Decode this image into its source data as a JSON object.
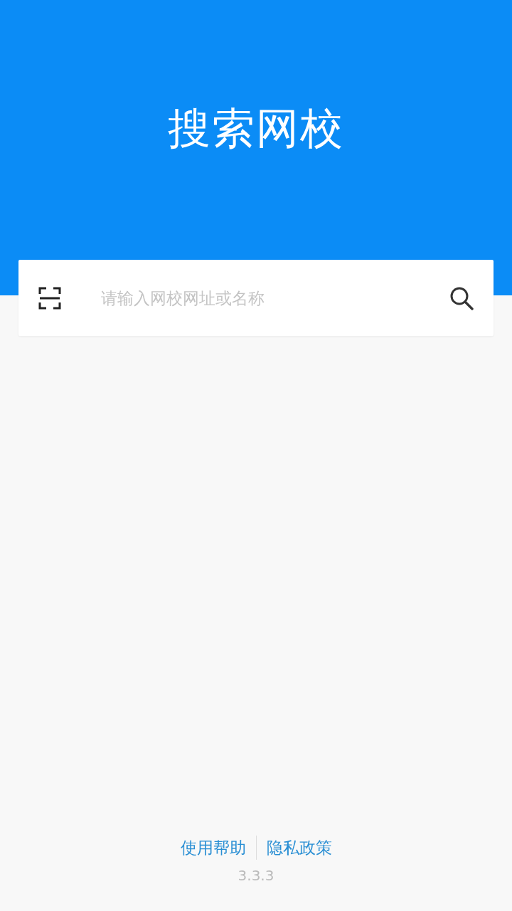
{
  "header": {
    "title": "搜索网校"
  },
  "search": {
    "placeholder": "请输入网校网址或名称"
  },
  "footer": {
    "links": [
      "使用帮助",
      "隐私政策"
    ],
    "version": "3.3.3"
  }
}
